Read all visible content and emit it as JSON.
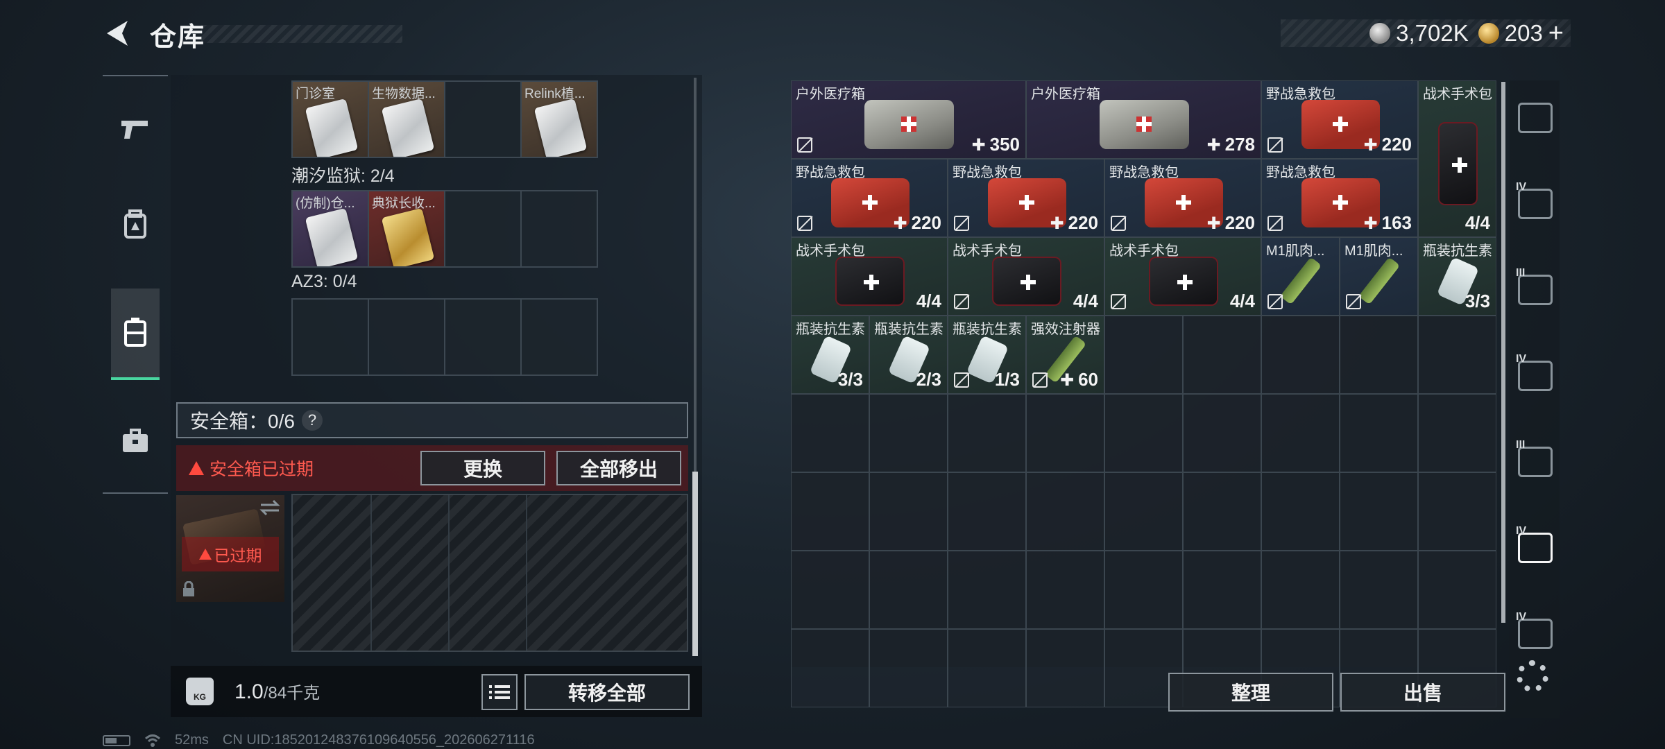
{
  "header": {
    "title": "仓库"
  },
  "currency": {
    "silver": "3,702K",
    "gold": "203",
    "gold_plus": "+"
  },
  "rail": {
    "items": [
      "weapon-icon",
      "backpack-icon",
      "container-icon",
      "toolbox-icon"
    ],
    "active_index": 2
  },
  "containers": {
    "top_row_names": [
      "门诊室",
      "生物数据...",
      "",
      "Relink植..."
    ],
    "sections": [
      {
        "label": "潮汐监狱: 2/4",
        "slots": [
          "(仿制)仓...",
          "典狱长收...",
          "",
          ""
        ]
      },
      {
        "label": "AZ3: 0/4",
        "slots": [
          "",
          "",
          "",
          ""
        ]
      }
    ]
  },
  "safebox": {
    "label": "安全箱：0/6",
    "help": "?",
    "expired_text": "安全箱已过期",
    "replace_button": "更换",
    "remove_all_button": "全部移出",
    "thumb_expired": "已过期"
  },
  "weight": {
    "current": "1.0",
    "max": "/84千克",
    "kg_label": "KG",
    "transfer_all_button": "转移全部"
  },
  "stash": {
    "items": [
      {
        "name": "户外医疗箱",
        "count": "350",
        "plus": true,
        "notrade": true,
        "pic": "grey",
        "tone": "purple",
        "col": 0,
        "row": 0,
        "w": 3,
        "h": 1
      },
      {
        "name": "户外医疗箱",
        "count": "278",
        "plus": true,
        "notrade": false,
        "pic": "grey",
        "tone": "purple",
        "col": 3,
        "row": 0,
        "w": 3,
        "h": 1
      },
      {
        "name": "野战急救包",
        "count": "220",
        "plus": true,
        "notrade": true,
        "pic": "red",
        "tone": "blue",
        "col": 6,
        "row": 0,
        "w": 2,
        "h": 1
      },
      {
        "name": "战术手术包",
        "count": "4/4",
        "plus": false,
        "notrade": false,
        "pic": "black",
        "tone": "green",
        "col": 8,
        "row": 0,
        "w": 1,
        "h": 2
      },
      {
        "name": "野战急救包",
        "count": "220",
        "plus": true,
        "notrade": true,
        "pic": "red",
        "tone": "blue",
        "col": 0,
        "row": 1,
        "w": 2,
        "h": 1
      },
      {
        "name": "野战急救包",
        "count": "220",
        "plus": true,
        "notrade": true,
        "pic": "red",
        "tone": "blue",
        "col": 2,
        "row": 1,
        "w": 2,
        "h": 1
      },
      {
        "name": "野战急救包",
        "count": "220",
        "plus": true,
        "notrade": true,
        "pic": "red",
        "tone": "blue",
        "col": 4,
        "row": 1,
        "w": 2,
        "h": 1
      },
      {
        "name": "野战急救包",
        "count": "163",
        "plus": true,
        "notrade": true,
        "pic": "red",
        "tone": "blue",
        "col": 6,
        "row": 1,
        "w": 2,
        "h": 1
      },
      {
        "name": "战术手术包",
        "count": "4/4",
        "plus": false,
        "notrade": false,
        "pic": "black",
        "tone": "green",
        "col": 0,
        "row": 2,
        "w": 2,
        "h": 1
      },
      {
        "name": "战术手术包",
        "count": "4/4",
        "plus": false,
        "notrade": true,
        "pic": "black",
        "tone": "green",
        "col": 2,
        "row": 2,
        "w": 2,
        "h": 1
      },
      {
        "name": "战术手术包",
        "count": "4/4",
        "plus": false,
        "notrade": true,
        "pic": "black",
        "tone": "green",
        "col": 4,
        "row": 2,
        "w": 2,
        "h": 1
      },
      {
        "name": "M1肌肉...",
        "count": "",
        "plus": false,
        "notrade": true,
        "pic": "inj",
        "tone": "blue",
        "col": 6,
        "row": 2,
        "w": 1,
        "h": 1
      },
      {
        "name": "M1肌肉...",
        "count": "",
        "plus": false,
        "notrade": true,
        "pic": "inj",
        "tone": "blue",
        "col": 7,
        "row": 2,
        "w": 1,
        "h": 1
      },
      {
        "name": "瓶装抗生素",
        "count": "3/3",
        "plus": false,
        "notrade": false,
        "pic": "vial",
        "tone": "green",
        "col": 8,
        "row": 2,
        "w": 1,
        "h": 1
      },
      {
        "name": "瓶装抗生素",
        "count": "3/3",
        "plus": false,
        "notrade": false,
        "pic": "vial",
        "tone": "green",
        "col": 0,
        "row": 3,
        "w": 1,
        "h": 1
      },
      {
        "name": "瓶装抗生素",
        "count": "2/3",
        "plus": false,
        "notrade": false,
        "pic": "vial",
        "tone": "green",
        "col": 1,
        "row": 3,
        "w": 1,
        "h": 1
      },
      {
        "name": "瓶装抗生素",
        "count": "1/3",
        "plus": false,
        "notrade": true,
        "pic": "vial",
        "tone": "green",
        "col": 2,
        "row": 3,
        "w": 1,
        "h": 1
      },
      {
        "name": "强效注射器",
        "count": "60",
        "plus": true,
        "notrade": true,
        "pic": "inj",
        "tone": "green",
        "col": 3,
        "row": 3,
        "w": 1,
        "h": 1
      }
    ],
    "sort_button": "整理",
    "sell_button": "出售"
  },
  "tabs": [
    {
      "icon": "helmet-icon",
      "level": ""
    },
    {
      "icon": "armor-iv-icon",
      "level": "IV"
    },
    {
      "icon": "armor-iii-icon",
      "level": "III"
    },
    {
      "icon": "armor-iv-2-icon",
      "level": "IV"
    },
    {
      "icon": "rig-iii-icon",
      "level": "III"
    },
    {
      "icon": "medkit-iv-icon",
      "level": "IV"
    },
    {
      "icon": "case-iv-icon",
      "level": "IV"
    }
  ],
  "status": {
    "ping": "52ms",
    "uid": "CN UID:18520124837610964055​6_202606271116"
  }
}
